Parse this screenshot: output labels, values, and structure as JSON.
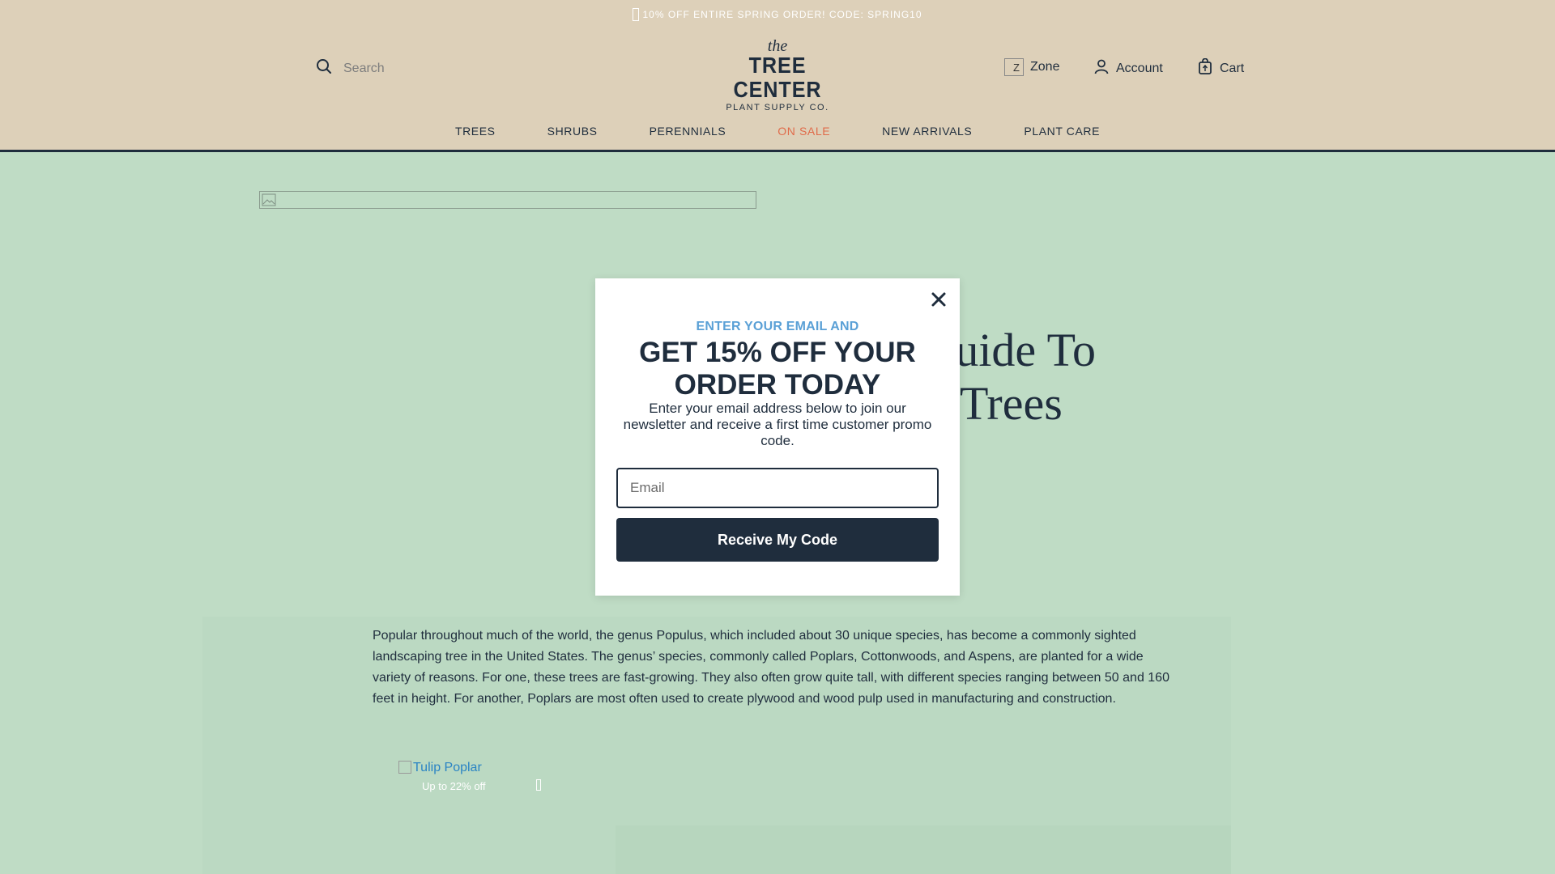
{
  "promo_bar": {
    "text": "10% OFF ENTIRE SPRING ORDER! CODE: SPRING10"
  },
  "header": {
    "search_placeholder": "Search",
    "logo": {
      "the": "the",
      "main": "TREE CENTER",
      "sub": "PLANT SUPPLY CO."
    },
    "zone_label": "Zone",
    "zone_img_text": "Z",
    "account_label": "Account",
    "cart_label": "Cart"
  },
  "nav": {
    "items": [
      "TREES",
      "SHRUBS",
      "PERENNIALS",
      "ON SALE",
      "NEW ARRIVALS",
      "PLANT CARE"
    ],
    "sale_color": "#e06b4a"
  },
  "page": {
    "title_line1": "-uide To",
    "title_line2": "Trees",
    "article_text": "Popular throughout much of the world, the genus Populus, which included about 30 unique species, has become a commonly sighted landscaping tree in the United States. The genus’ species, commonly called Poplars, Cottonwoods, and Aspens, are planted for a wide variety of reasons. For one, these trees are fast-growing. They also often grow quite tall, with different species ranging between 50 and 160 feet in height. For another, Poplars are most often used to create plywood and wood pulp used in manufacturing and construction."
  },
  "product_card": {
    "name": "Tulip Poplar",
    "discount": "Up to 22% off"
  },
  "modal": {
    "kicker": "ENTER YOUR EMAIL AND",
    "headline": "GET 15% OFF YOUR ORDER TODAY",
    "description": "Enter your email address below to join our newsletter and receive a first time customer promo code.",
    "email_placeholder": "Email",
    "submit_label": "Receive My Code",
    "close_icon": "close-icon"
  },
  "colors": {
    "header_bg": "#ddd0b9",
    "page_bg": "#bfdcc5",
    "navy": "#1f2d3d",
    "kicker_blue": "#5aa0d6",
    "link_blue": "#2a84c4"
  }
}
